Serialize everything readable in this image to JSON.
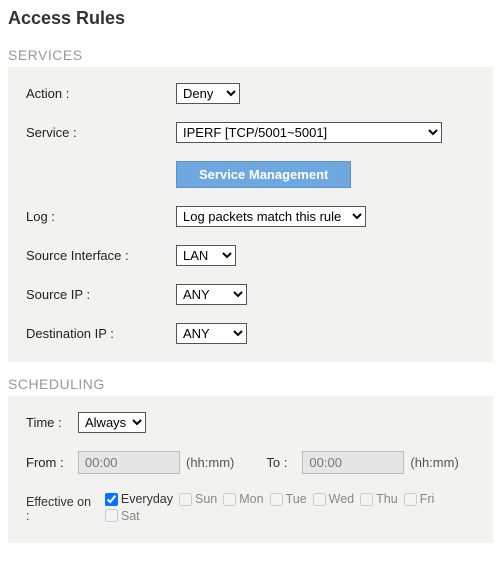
{
  "title": "Access Rules",
  "sections": {
    "services": {
      "header": "SERVICES",
      "action": {
        "label": "Action :",
        "value": "Deny"
      },
      "service": {
        "label": "Service :",
        "value": "IPERF [TCP/5001~5001]"
      },
      "service_mgmt_btn": "Service Management",
      "log": {
        "label": "Log :",
        "value": "Log packets match this rule"
      },
      "source_iface": {
        "label": "Source Interface :",
        "value": "LAN"
      },
      "source_ip": {
        "label": "Source IP :",
        "value": "ANY"
      },
      "dest_ip": {
        "label": "Destination IP :",
        "value": "ANY"
      }
    },
    "scheduling": {
      "header": "SCHEDULING",
      "time": {
        "label": "Time :",
        "value": "Always"
      },
      "from": {
        "label": "From :",
        "value": "00:00",
        "hint": "(hh:mm)"
      },
      "to": {
        "label": "To :",
        "value": "00:00",
        "hint": "(hh:mm)"
      },
      "effective": {
        "label": "Effective on :",
        "days": [
          {
            "name": "Everyday",
            "checked": true,
            "enabled": true
          },
          {
            "name": "Sun",
            "checked": false,
            "enabled": false
          },
          {
            "name": "Mon",
            "checked": false,
            "enabled": false
          },
          {
            "name": "Tue",
            "checked": false,
            "enabled": false
          },
          {
            "name": "Wed",
            "checked": false,
            "enabled": false
          },
          {
            "name": "Thu",
            "checked": false,
            "enabled": false
          },
          {
            "name": "Fri",
            "checked": false,
            "enabled": false
          },
          {
            "name": "Sat",
            "checked": false,
            "enabled": false
          }
        ]
      }
    }
  }
}
